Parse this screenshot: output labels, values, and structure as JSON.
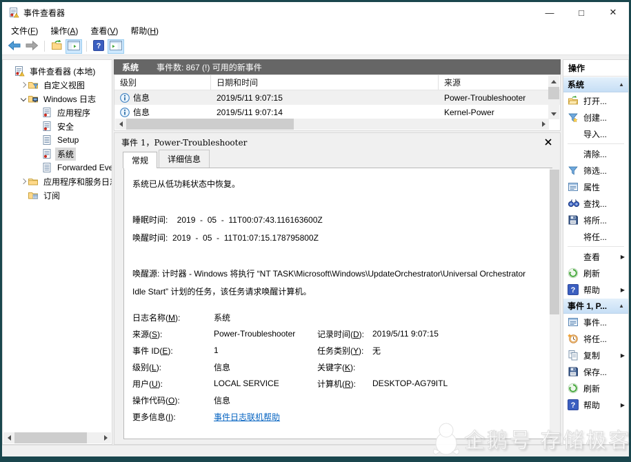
{
  "window": {
    "title": "事件查看器",
    "controls": [
      {
        "name": "minimize",
        "glyph": "—"
      },
      {
        "name": "maximize",
        "glyph": "□"
      },
      {
        "name": "close",
        "glyph": "✕"
      }
    ]
  },
  "menu": {
    "items": [
      "文件(F)",
      "操作(A)",
      "查看(V)",
      "帮助(H)"
    ]
  },
  "toolbar": {
    "buttons": [
      {
        "icon": "back-arrow"
      },
      {
        "icon": "forward-arrow"
      },
      {
        "icon": "separator"
      },
      {
        "icon": "open-saved-log"
      },
      {
        "icon": "console-tree-toggle",
        "active": true
      },
      {
        "icon": "separator"
      },
      {
        "icon": "help"
      },
      {
        "icon": "action-pane-toggle",
        "active": true
      }
    ]
  },
  "tree": {
    "items": [
      {
        "label": "事件查看器 (本地)",
        "icon": "event-viewer",
        "level": 0
      },
      {
        "label": "自定义视图",
        "icon": "folder-filter",
        "level": 1,
        "expander": "collapsed"
      },
      {
        "label": "Windows 日志",
        "icon": "folder-computer",
        "level": 1,
        "expander": "expanded"
      },
      {
        "label": "应用程序",
        "icon": "event-log",
        "level": 2
      },
      {
        "label": "安全",
        "icon": "event-log",
        "level": 2
      },
      {
        "label": "Setup",
        "icon": "event-log-plain",
        "level": 2
      },
      {
        "label": "系统",
        "icon": "event-log",
        "level": 2,
        "selected": true
      },
      {
        "label": "Forwarded Even",
        "icon": "event-log-plain",
        "level": 2
      },
      {
        "label": "应用程序和服务日志",
        "icon": "folder",
        "level": 1,
        "expander": "collapsed"
      },
      {
        "label": "订阅",
        "icon": "subscription",
        "level": 1
      }
    ]
  },
  "list": {
    "title": "系统",
    "subtitle": "事件数: 867 (!) 可用的新事件",
    "columns": [
      "级别",
      "日期和时间",
      "来源"
    ],
    "rows": [
      {
        "level": "信息",
        "datetime": "2019/5/11 9:07:15",
        "source": "Power-Troubleshooter",
        "selected": true
      },
      {
        "level": "信息",
        "datetime": "2019/5/11 9:07:14",
        "source": "Kernel-Power",
        "selected": false
      }
    ]
  },
  "detail": {
    "title": "事件 1，Power-Troubleshooter",
    "tabs": [
      {
        "label": "常规",
        "active": true
      },
      {
        "label": "详细信息",
        "active": false
      }
    ],
    "description": [
      "系统已从低功耗状态中恢复。",
      "",
      "睡眠时间:    2019  -  05  -  11T00:07:43.116163600Z",
      "唤醒时间:  2019  -  05  -  11T01:07:15.178795800Z",
      "",
      "唤醒源: 计时器 - Windows 将执行 “NT TASK\\Microsoft\\Windows\\UpdateOrchestrator\\Universal Orchestrator Idle Start” 计划的任务，该任务请求唤醒计算机。"
    ],
    "fields": [
      {
        "label": "日志名称(M):",
        "value": "系统",
        "label2": "",
        "value2": ""
      },
      {
        "label": "来源(S):",
        "value": "Power-Troubleshooter",
        "label2": "记录时间(D):",
        "value2": "2019/5/11 9:07:15"
      },
      {
        "label": "事件 ID(E):",
        "value": "1",
        "label2": "任务类别(Y):",
        "value2": "无"
      },
      {
        "label": "级别(L):",
        "value": "信息",
        "label2": "关键字(K):",
        "value2": ""
      },
      {
        "label": "用户(U):",
        "value": "LOCAL SERVICE",
        "label2": "计算机(R):",
        "value2": "DESKTOP-AG79ITL"
      },
      {
        "label": "操作代码(O):",
        "value": "信息",
        "label2": "",
        "value2": ""
      },
      {
        "label": "更多信息(I):",
        "value": "事件日志联机帮助",
        "label2": "",
        "value2": "",
        "link": true
      }
    ]
  },
  "actions": {
    "title": "操作",
    "sections": [
      {
        "header": "系统",
        "items": [
          {
            "icon": "open-folder",
            "label": "打开..."
          },
          {
            "icon": "create-filter",
            "label": "创建..."
          },
          {
            "icon": "blank",
            "label": "导入..."
          },
          {
            "separator": true
          },
          {
            "icon": "blank",
            "label": "清除..."
          },
          {
            "icon": "filter",
            "label": "筛选..."
          },
          {
            "icon": "properties",
            "label": "属性"
          },
          {
            "icon": "find",
            "label": "查找..."
          },
          {
            "icon": "save",
            "label": "将所..."
          },
          {
            "icon": "blank",
            "label": "将任..."
          },
          {
            "separator": true
          },
          {
            "icon": "blank",
            "label": "查看",
            "submenu": true
          },
          {
            "icon": "refresh",
            "label": "刷新"
          },
          {
            "icon": "help",
            "label": "帮助",
            "submenu": true
          }
        ]
      },
      {
        "header": "事件 1, P...",
        "items": [
          {
            "icon": "properties",
            "label": "事件..."
          },
          {
            "icon": "task",
            "label": "将任..."
          },
          {
            "icon": "copy",
            "label": "复制",
            "submenu": true
          },
          {
            "icon": "save",
            "label": "保存..."
          },
          {
            "icon": "refresh",
            "label": "刷新"
          },
          {
            "icon": "help",
            "label": "帮助",
            "submenu": true
          }
        ]
      }
    ]
  },
  "watermark": {
    "text": "企鹅号 存储极客"
  }
}
